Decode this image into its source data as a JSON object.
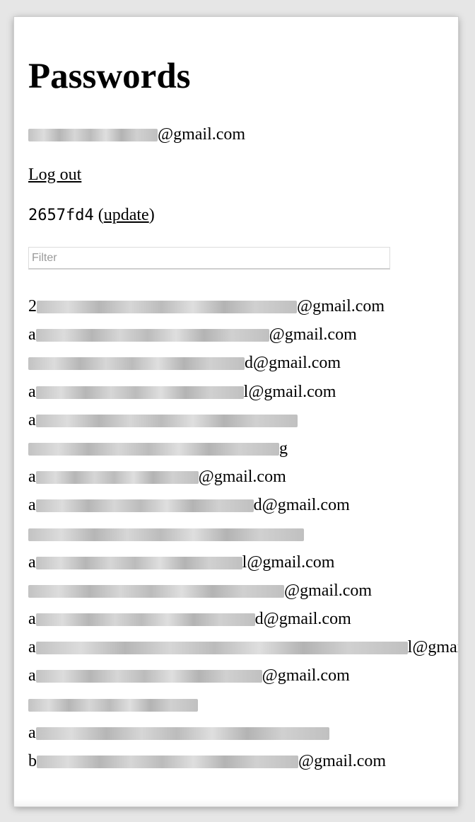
{
  "page": {
    "title": "Passwords",
    "account_suffix": "@gmail.com",
    "logout_label": "Log out",
    "version": {
      "hash": "2657fd4",
      "open_paren": " (",
      "update_label": "update",
      "close_paren": ")"
    },
    "filter": {
      "placeholder": "Filter",
      "value": ""
    }
  },
  "entries": [
    {
      "prefix": "2",
      "suffix": "@gmail.com"
    },
    {
      "prefix": "a",
      "suffix": "@gmail.com"
    },
    {
      "prefix": "",
      "suffix": "d@gmail.com"
    },
    {
      "prefix": "a",
      "suffix": "l@gmail.com"
    },
    {
      "prefix": "a",
      "suffix": ""
    },
    {
      "prefix": "",
      "suffix": "g"
    },
    {
      "prefix": "a",
      "suffix": "@gmail.com"
    },
    {
      "prefix": "a",
      "suffix": "d@gmail.com"
    },
    {
      "prefix": "",
      "suffix": ""
    },
    {
      "prefix": "a",
      "suffix": "l@gmail.com"
    },
    {
      "prefix": "",
      "suffix": "@gmail.com"
    },
    {
      "prefix": "a",
      "suffix": "d@gmail.com"
    },
    {
      "prefix": "a",
      "suffix": "l@gmail.com"
    },
    {
      "prefix": "a",
      "suffix": "@gmail.com"
    },
    {
      "prefix": "",
      "suffix": ""
    },
    {
      "prefix": "a",
      "suffix": ""
    },
    {
      "prefix": "b",
      "suffix": "@gmail.com"
    }
  ]
}
